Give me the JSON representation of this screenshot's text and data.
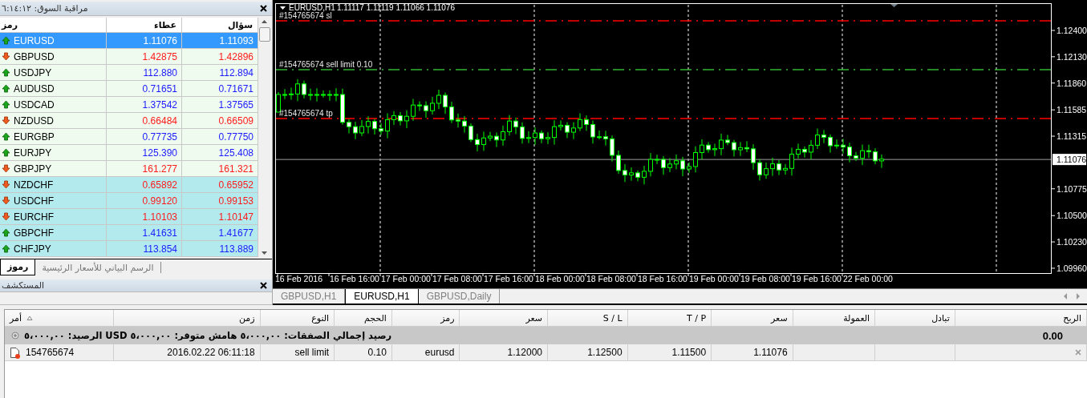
{
  "market_watch": {
    "title": "مراقبة السوق: ٦:١٤:١٢",
    "columns": [
      "سؤال",
      "عطاء",
      "رمز"
    ],
    "rows": [
      {
        "symbol": "EURUSD",
        "bid": "1.11076",
        "ask": "1.11093",
        "kind": "up",
        "selected": true
      },
      {
        "symbol": "GBPUSD",
        "bid": "1.42875",
        "ask": "1.42896",
        "kind": "down",
        "selected": false,
        "color": "#effbee"
      },
      {
        "symbol": "USDJPY",
        "bid": "112.880",
        "ask": "112.894",
        "kind": "up",
        "selected": false,
        "color": "#effbee"
      },
      {
        "symbol": "AUDUSD",
        "bid": "0.71651",
        "ask": "0.71671",
        "kind": "up",
        "selected": false,
        "color": "#effbee"
      },
      {
        "symbol": "USDCAD",
        "bid": "1.37542",
        "ask": "1.37565",
        "kind": "up",
        "selected": false,
        "color": "#effbee"
      },
      {
        "symbol": "NZDUSD",
        "bid": "0.66484",
        "ask": "0.66509",
        "kind": "down",
        "selected": false,
        "color": "#effbee"
      },
      {
        "symbol": "EURGBP",
        "bid": "0.77735",
        "ask": "0.77750",
        "kind": "up",
        "selected": false,
        "color": "#effbee"
      },
      {
        "symbol": "EURJPY",
        "bid": "125.390",
        "ask": "125.408",
        "kind": "up",
        "selected": false,
        "color": "#effbee"
      },
      {
        "symbol": "GBPJPY",
        "bid": "161.277",
        "ask": "161.321",
        "kind": "down",
        "selected": false,
        "color": "#effbee"
      },
      {
        "symbol": "NZDCHF",
        "bid": "0.65892",
        "ask": "0.65952",
        "kind": "down",
        "selected": false,
        "color": "#b3eaee"
      },
      {
        "symbol": "USDCHF",
        "bid": "0.99120",
        "ask": "0.99153",
        "kind": "down",
        "selected": false,
        "color": "#b3eaee"
      },
      {
        "symbol": "EURCHF",
        "bid": "1.10103",
        "ask": "1.10147",
        "kind": "down",
        "selected": false,
        "color": "#b3eaee"
      },
      {
        "symbol": "GBPCHF",
        "bid": "1.41631",
        "ask": "1.41677",
        "kind": "up",
        "selected": false,
        "color": "#b3eaee"
      },
      {
        "symbol": "CHFJPY",
        "bid": "113.854",
        "ask": "113.889",
        "kind": "up",
        "selected": false,
        "color": "#b3eaee"
      }
    ],
    "tabs": [
      {
        "label": "الرسم البياني للأسعار الرئيسية",
        "selected": false
      },
      {
        "label": "رموز",
        "selected": true
      }
    ]
  },
  "navigator": {
    "title": "المستكشف"
  },
  "chart": {
    "symbol": "EURUSD,H1",
    "quote": "1.11117 1.11119 1.11066 1.11076",
    "order_lines": [
      {
        "label": "#154765674 sl",
        "kind": "sl"
      },
      {
        "label": "#154765674 sell limit 0.10",
        "kind": "limit"
      },
      {
        "label": "#154765674 tp",
        "kind": "tp"
      }
    ],
    "price_ticks": [
      "1.12400",
      "1.12130",
      "1.11860",
      "1.11585",
      "1.11315",
      "1.10775",
      "1.10500",
      "1.10230",
      "1.09960"
    ],
    "current_price": "1.11076",
    "time_labels": [
      "16 Feb 2016",
      "16 Feb 16:00",
      "17 Feb 00:00",
      "17 Feb 08:00",
      "17 Feb 16:00",
      "18 Feb 00:00",
      "18 Feb 08:00",
      "18 Feb 16:00",
      "19 Feb 00:00",
      "19 Feb 08:00",
      "19 Feb 16:00",
      "22 Feb 00:00"
    ]
  },
  "chart_tabs": [
    {
      "label": "GBPUSD,H1",
      "selected": false
    },
    {
      "label": "EURUSD,H1",
      "selected": true
    },
    {
      "label": "GBPUSD,Daily",
      "selected": false
    }
  ],
  "terminal": {
    "columns": [
      "الربح",
      "تبادل",
      "العمولة",
      "سعر",
      "T / P",
      "S / L",
      "سعر",
      "رمز",
      "الحجم",
      "النوع",
      "زمن",
      "أمر"
    ],
    "balance": "رصيد إجمالي الصفقات: ٥،٠٠٠,٠٠  هامش متوفر: ٥،٠٠٠,٠٠  USD الرصيد: ٥،٠٠٠,٠٠",
    "profit_total": "0.00",
    "orders": [
      {
        "ticket": "154765674",
        "time": "2016.02.22 06:11:18",
        "type": "sell limit",
        "volume": "0.10",
        "symbol": "eurusd",
        "price": "1.12000",
        "sl": "1.12500",
        "tp": "1.11500",
        "current_price": "1.11076"
      }
    ]
  }
}
